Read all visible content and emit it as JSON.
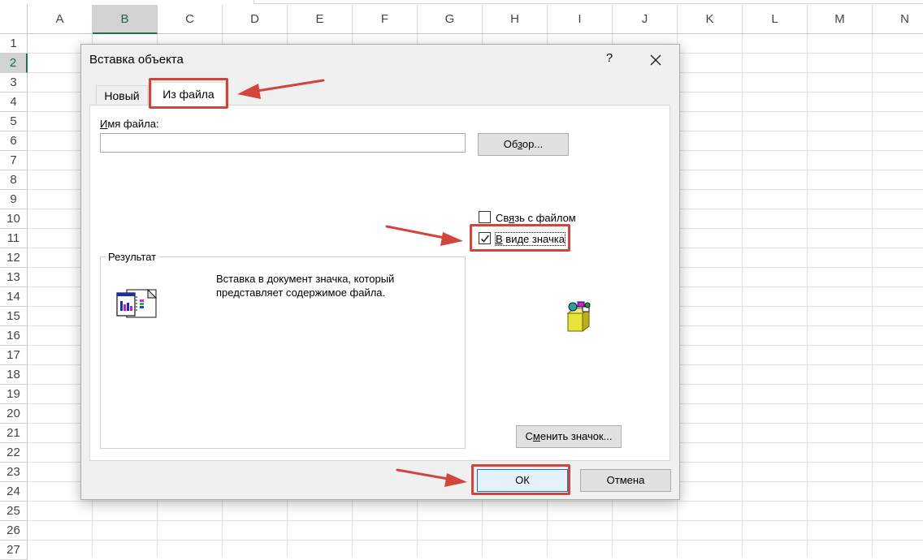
{
  "spreadsheet": {
    "columns": [
      "A",
      "B",
      "C",
      "D",
      "E",
      "F",
      "G",
      "H",
      "I",
      "J",
      "K",
      "L",
      "M",
      "N"
    ],
    "rows": [
      "1",
      "2",
      "3",
      "4",
      "5",
      "6",
      "7",
      "8",
      "9",
      "10",
      "11",
      "12",
      "13",
      "14",
      "15",
      "16",
      "17",
      "18",
      "19",
      "20",
      "21",
      "22",
      "23",
      "24",
      "25",
      "26",
      "27"
    ],
    "selected_column": "B",
    "selected_row": "2"
  },
  "dialog": {
    "title": "Вставка объекта",
    "help": "?",
    "tabs": {
      "new": "Новый",
      "from_file": "Из файла"
    },
    "filename_label_hotkey": "И",
    "filename_label_rest": "мя файла:",
    "filename_value": "",
    "browse_pre": "Об",
    "browse_hotkey": "з",
    "browse_post": "ор...",
    "link_label_pre": "Св",
    "link_label_hotkey": "я",
    "link_label_post": "зь с файлом",
    "link_checked": false,
    "as_icon_hotkey": "В",
    "as_icon_rest": " виде значка",
    "as_icon_checked": true,
    "result_legend": "Результат",
    "result_line1": "Вставка в документ значка, который",
    "result_line2": "представляет содержимое файла.",
    "change_icon_pre": "С",
    "change_icon_hotkey": "м",
    "change_icon_post": "енить значок...",
    "ok": "ОК",
    "cancel": "Отмена"
  },
  "colors": {
    "annotation": "#d2453b",
    "excel_green": "#217346",
    "dialog_bg": "#f0f0f0"
  }
}
